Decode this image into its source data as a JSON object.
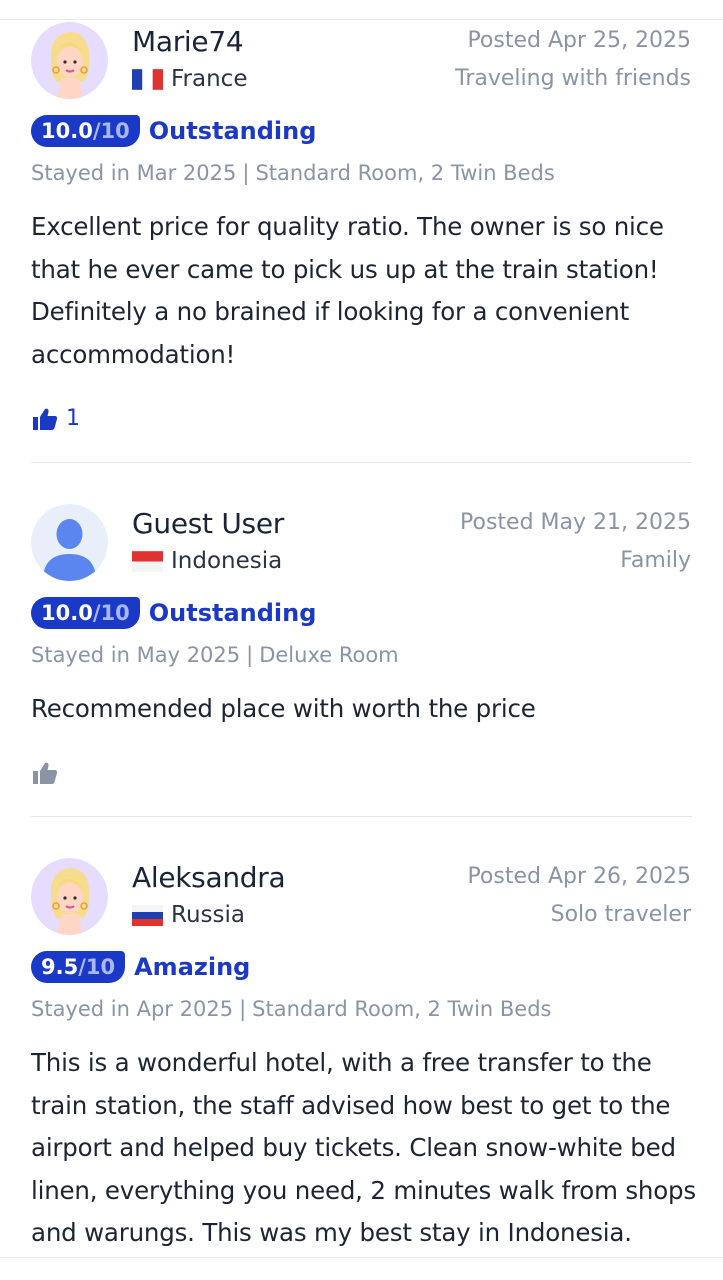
{
  "reviews": [
    {
      "name": "Marie74",
      "country": "France",
      "posted": "Posted Apr 25, 2025",
      "trip_type": "Traveling with friends",
      "score": "10.0",
      "score_out": "/10",
      "score_label": "Outstanding",
      "stayed": "Stayed in Mar 2025",
      "room": "Standard Room, 2 Twin Beds",
      "text": "Excellent price for quality ratio. The owner is so nice that he ever came to pick us up at the train station! Definitely a no brained if looking for a convenient accommodation!",
      "likes": "1",
      "avatar": "woman-avatar-icon",
      "flag": "france-flag-icon"
    },
    {
      "name": "Guest User",
      "country": "Indonesia",
      "posted": "Posted May 21, 2025",
      "trip_type": "Family",
      "score": "10.0",
      "score_out": "/10",
      "score_label": "Outstanding",
      "stayed": "Stayed in May 2025",
      "room": "Deluxe Room",
      "text": "Recommended place with worth the price",
      "likes": "",
      "avatar": "guest-user-avatar-icon",
      "flag": "indonesia-flag-icon"
    },
    {
      "name": "Aleksandra",
      "country": "Russia",
      "posted": "Posted Apr 26, 2025",
      "trip_type": "Solo traveler",
      "score": "9.5",
      "score_out": "/10",
      "score_label": "Amazing",
      "stayed": "Stayed in Apr 2025",
      "room": "Standard Room, 2 Twin Beds",
      "text": "This is a wonderful hotel, with a free transfer to the train station, the staff advised how best to get to the airport and helped buy tickets. Clean snow-white bed linen, everything you need, 2 minutes walk from shops and warungs. This was my best stay in Indonesia. Good",
      "likes": "",
      "avatar": "woman-avatar-icon",
      "flag": "russia-flag-icon"
    }
  ],
  "colors": {
    "accent": "#1b39c7",
    "muted": "#8a94a6",
    "text": "#1d2433",
    "like_inactive": "#8a94a6"
  }
}
